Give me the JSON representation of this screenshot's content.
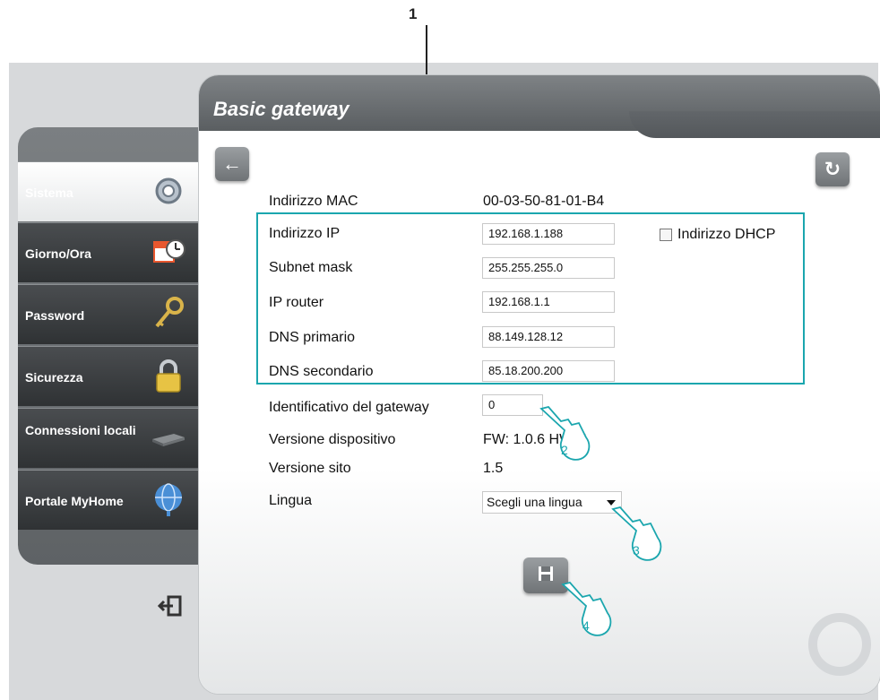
{
  "callout_label": "1",
  "window": {
    "title": "Basic gateway"
  },
  "sidebar": {
    "items": [
      {
        "label": "Sistema",
        "icon": "gear-icon",
        "active": true
      },
      {
        "label": "Giorno/Ora",
        "icon": "calendar-clock-icon"
      },
      {
        "label": "Password",
        "icon": "key-icon"
      },
      {
        "label": "Sicurezza",
        "icon": "padlock-icon"
      },
      {
        "label": "Connessioni locali",
        "icon": "network-switch-icon"
      },
      {
        "label": "Portale MyHome",
        "icon": "globe-icon"
      }
    ]
  },
  "form": {
    "mac_label": "Indirizzo MAC",
    "mac_value": "00-03-50-81-01-B4",
    "ip_label": "Indirizzo IP",
    "ip_value": "192.168.1.188",
    "dhcp_label": "Indirizzo DHCP",
    "subnet_label": "Subnet mask",
    "subnet_value": "255.255.255.0",
    "router_label": "IP router",
    "router_value": "192.168.1.1",
    "dns1_label": "DNS primario",
    "dns1_value": "88.149.128.12",
    "dns2_label": "DNS secondario",
    "dns2_value": "85.18.200.200",
    "gateway_id_label": "Identificativo del gateway",
    "gateway_id_value": "0",
    "device_version_label": "Versione dispositivo",
    "device_version_value": "FW: 1.0.6  HW: 1",
    "site_version_label": "Versione sito",
    "site_version_value": "1.5",
    "language_label": "Lingua",
    "language_value": "Scegli una lingua"
  },
  "hands": {
    "h2": "2",
    "h3": "3",
    "h4": "4"
  },
  "colors": {
    "highlight": "#1ba6ae"
  }
}
